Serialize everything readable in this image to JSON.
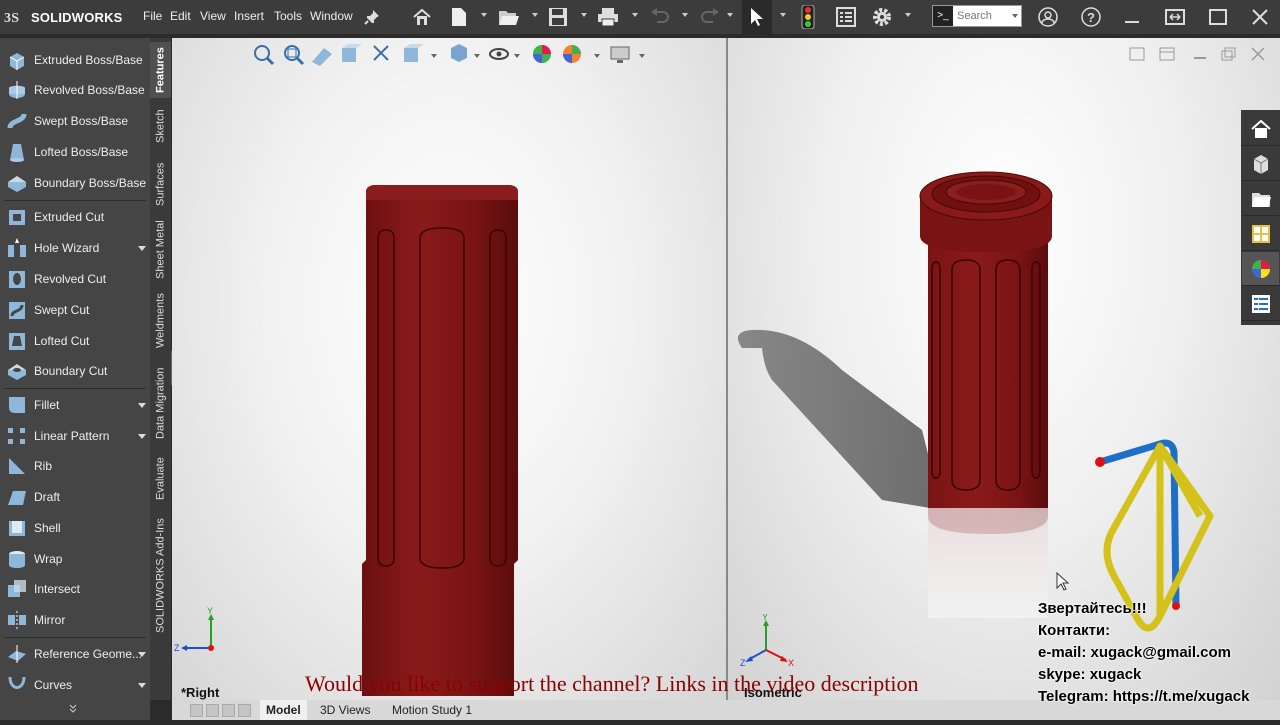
{
  "app": {
    "name": "SOLIDWORKS"
  },
  "menu": [
    "File",
    "Edit",
    "View",
    "Insert",
    "Tools",
    "Window"
  ],
  "search": {
    "placeholder": "Search"
  },
  "commands": [
    {
      "label": "Extruded Boss/Base",
      "icon": "extruded-boss-icon"
    },
    {
      "label": "Revolved Boss/Base",
      "icon": "revolved-boss-icon"
    },
    {
      "label": "Swept Boss/Base",
      "icon": "swept-boss-icon"
    },
    {
      "label": "Lofted Boss/Base",
      "icon": "lofted-boss-icon"
    },
    {
      "label": "Boundary Boss/Base",
      "icon": "boundary-boss-icon"
    },
    {
      "label": "Extruded Cut",
      "icon": "extruded-cut-icon"
    },
    {
      "label": "Hole Wizard",
      "icon": "hole-wizard-icon"
    },
    {
      "label": "Revolved Cut",
      "icon": "revolved-cut-icon"
    },
    {
      "label": "Swept Cut",
      "icon": "swept-cut-icon"
    },
    {
      "label": "Lofted Cut",
      "icon": "lofted-cut-icon"
    },
    {
      "label": "Boundary Cut",
      "icon": "boundary-cut-icon"
    },
    {
      "label": "Fillet",
      "icon": "fillet-icon"
    },
    {
      "label": "Linear Pattern",
      "icon": "linear-pattern-icon"
    },
    {
      "label": "Rib",
      "icon": "rib-icon"
    },
    {
      "label": "Draft",
      "icon": "draft-icon"
    },
    {
      "label": "Shell",
      "icon": "shell-icon"
    },
    {
      "label": "Wrap",
      "icon": "wrap-icon"
    },
    {
      "label": "Intersect",
      "icon": "intersect-icon"
    },
    {
      "label": "Mirror",
      "icon": "mirror-icon"
    },
    {
      "label": "Reference Geome...",
      "icon": "reference-geometry-icon"
    },
    {
      "label": "Curves",
      "icon": "curves-icon"
    }
  ],
  "command_tabs": [
    "Features",
    "Sketch",
    "Surfaces",
    "Sheet Metal",
    "Weldments",
    "Data Migration",
    "Evaluate",
    "SOLIDWORKS Add-Ins"
  ],
  "viewports": {
    "left": {
      "label": "*Right",
      "axes": [
        "Y",
        "Z"
      ]
    },
    "right": {
      "label": "Isometric",
      "axes": [
        "Y",
        "Z",
        "X"
      ]
    }
  },
  "bottom_tabs": [
    "Model",
    "3D Views",
    "Motion Study 1"
  ],
  "overlay": {
    "banner": "Would you like to support the channel? Links in the video description",
    "contacts": [
      "Звертайтесь!!!",
      "Контакти:",
      "e-mail: xugack@gmail.com",
      "skype: xugack",
      "Telegram: https://t.me/xugack"
    ]
  },
  "colors": {
    "part": "#7a1414",
    "topbar": "#3c3c3c",
    "panel": "#454545",
    "banner": "#8b0000"
  }
}
